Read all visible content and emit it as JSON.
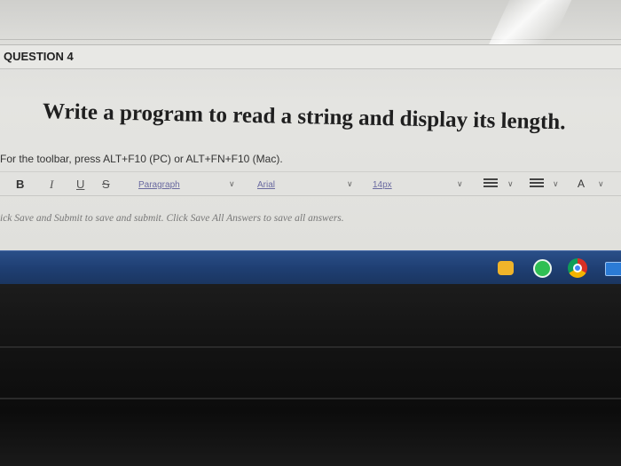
{
  "question": {
    "header": "QUESTION 4",
    "prompt": "Write a program to read a string and display its length."
  },
  "editor": {
    "toolbar_hint": "For the toolbar, press ALT+F10 (PC) or ALT+FN+F10 (Mac).",
    "bold_label": "B",
    "italic_label": "I",
    "underline_label": "U",
    "strike_label": "S",
    "paragraph_value": "Paragraph",
    "font_value": "Arial",
    "size_value": "14px",
    "font_color_label": "A"
  },
  "footer": {
    "save_hint": "ick Save and Submit to save and submit. Click Save All Answers to save all answers."
  },
  "taskbar": {
    "tray_icons": [
      "lock-icon",
      "whatsapp-icon",
      "chrome-icon",
      "mail-icon"
    ]
  }
}
